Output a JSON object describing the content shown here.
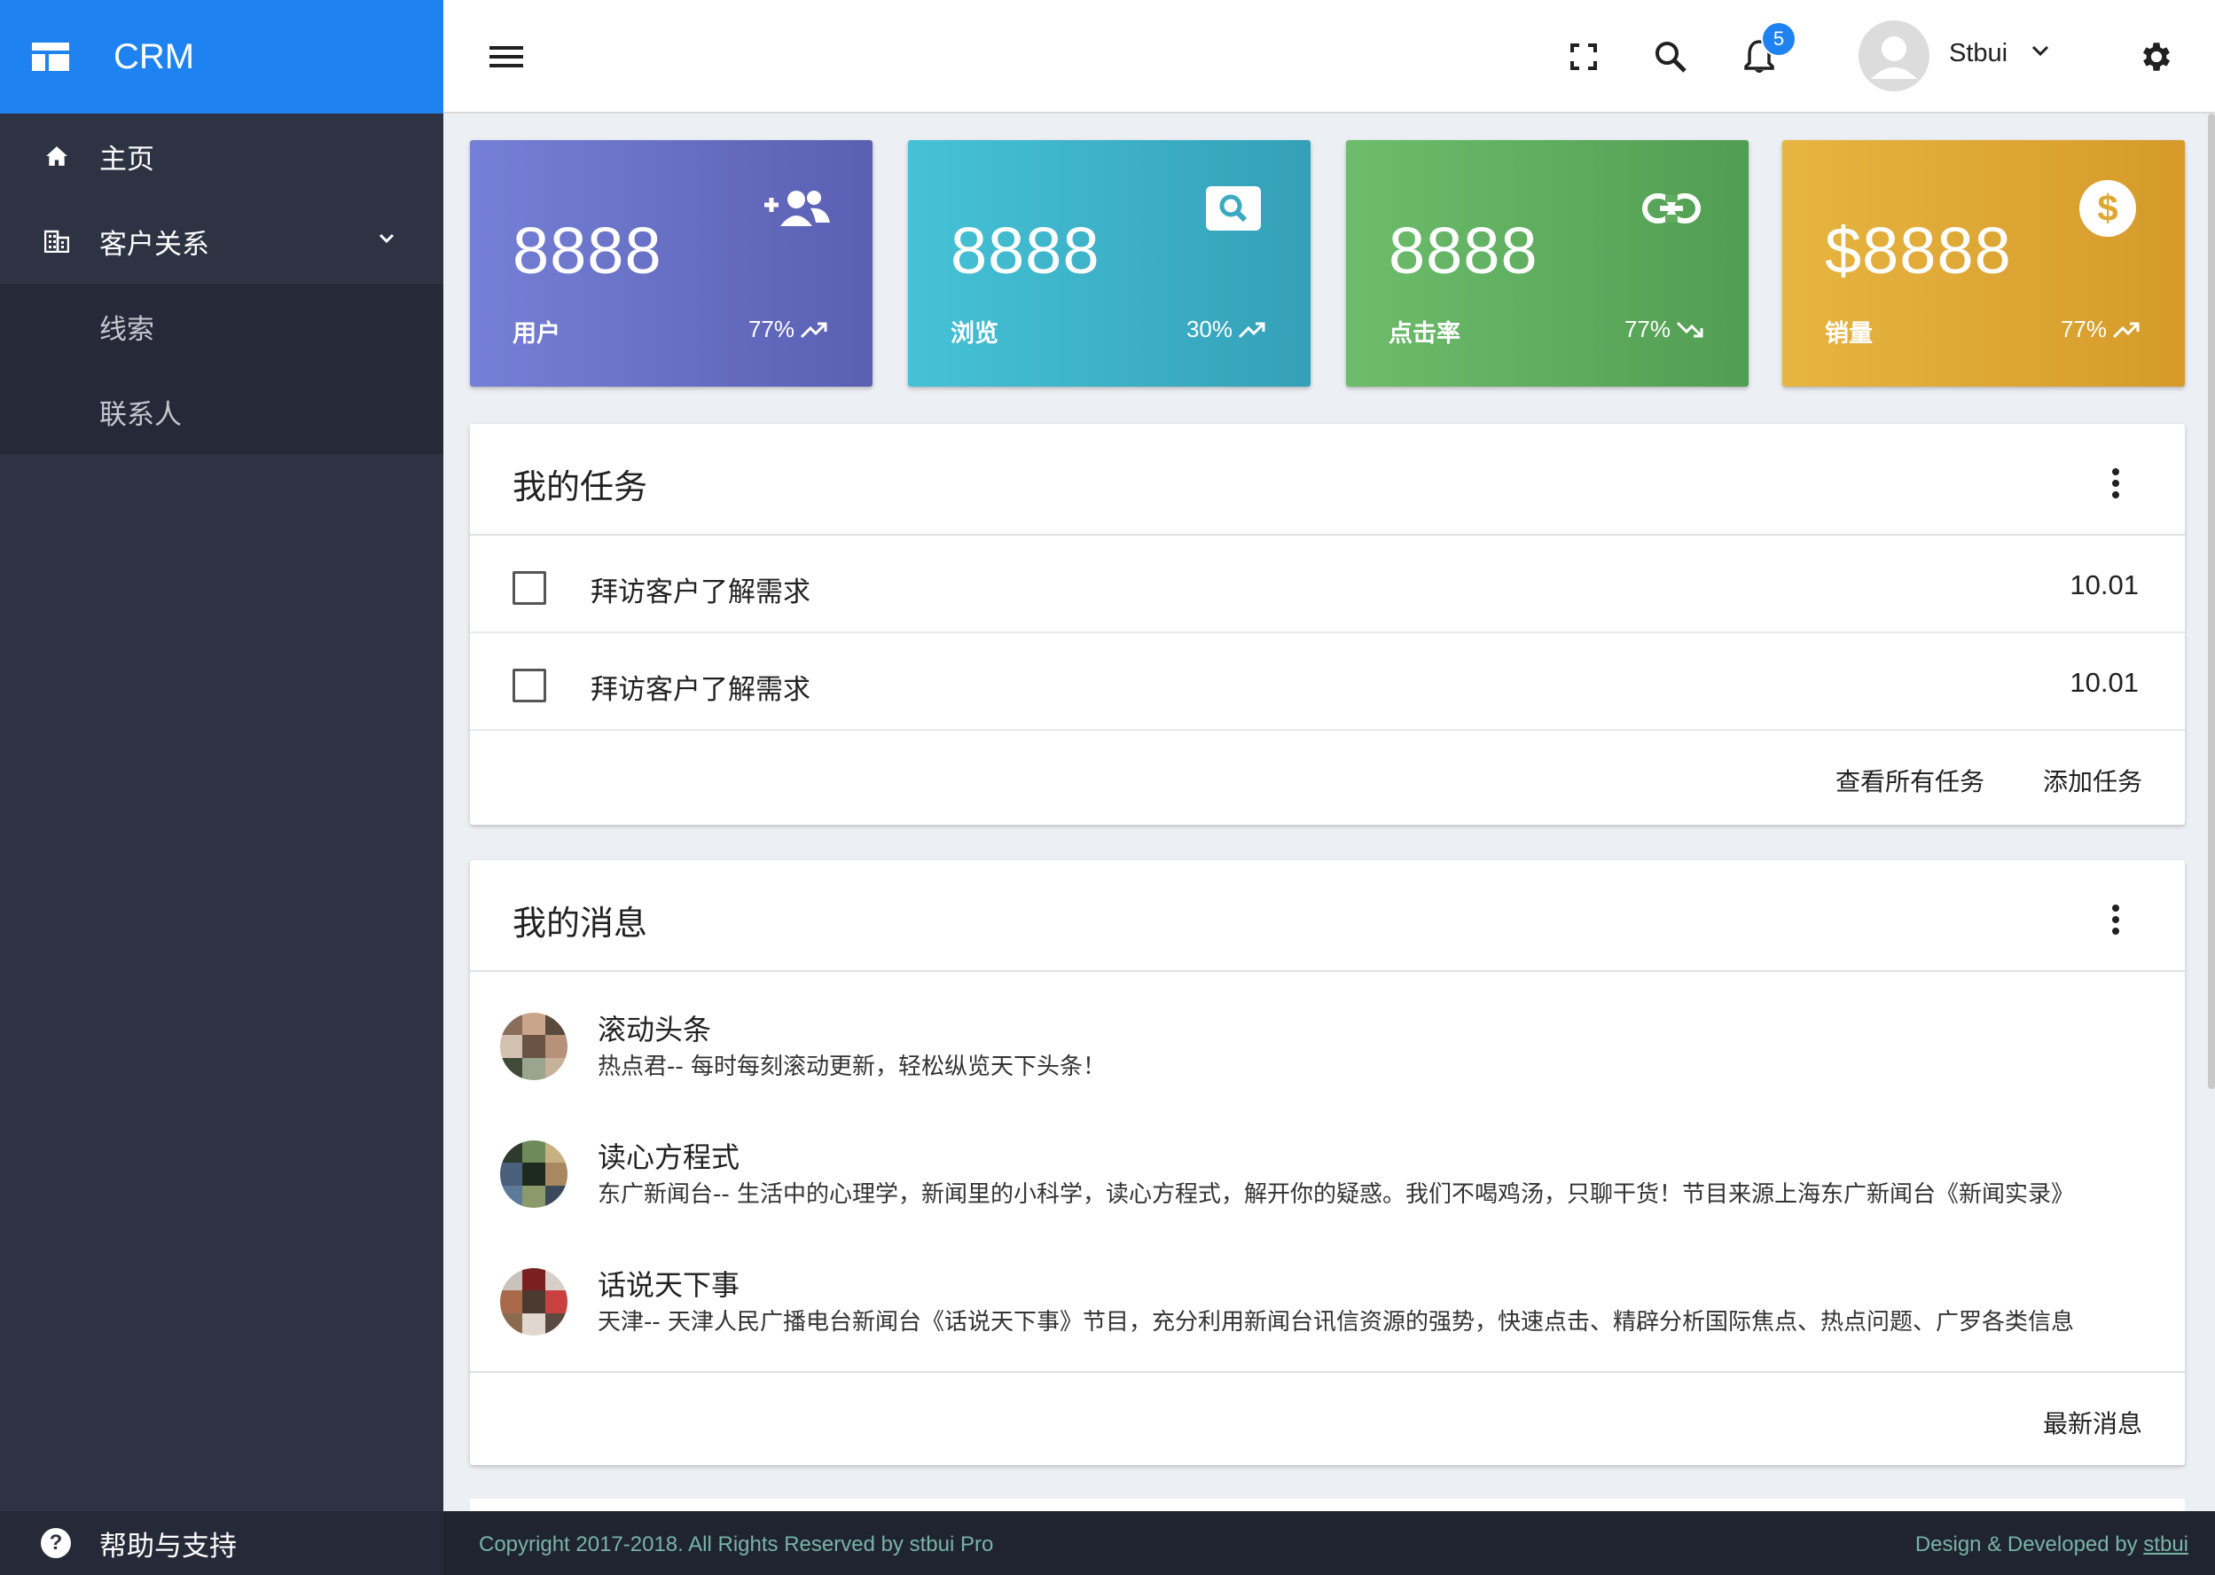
{
  "brand": {
    "name": "CRM"
  },
  "sidebar": {
    "items": [
      {
        "label": "主页",
        "icon": "home-icon"
      },
      {
        "label": "客户关系",
        "icon": "building-icon",
        "expanded": true
      }
    ],
    "subitems": [
      {
        "label": "线索"
      },
      {
        "label": "联系人"
      }
    ],
    "help": {
      "label": "帮助与支持"
    }
  },
  "topbar": {
    "notification_count": "5",
    "username": "Stbui"
  },
  "stats": [
    {
      "value": "8888",
      "label": "用户",
      "percent": "77%",
      "trend": "up",
      "icon": "add-group-icon",
      "color_from": "#7480d6",
      "color_to": "#5a5fb2"
    },
    {
      "value": "8888",
      "label": "浏览",
      "percent": "30%",
      "trend": "up",
      "icon": "search-box-icon",
      "color_from": "#45c2d6",
      "color_to": "#34a0b8"
    },
    {
      "value": "8888",
      "label": "点击率",
      "percent": "77%",
      "trend": "down",
      "icon": "link-icon",
      "color_from": "#6dbd6c",
      "color_to": "#519d52"
    },
    {
      "value": "$8888",
      "label": "销量",
      "percent": "77%",
      "trend": "up",
      "icon": "dollar-icon",
      "color_from": "#e7b541",
      "color_to": "#d59a2a"
    }
  ],
  "tasks_panel": {
    "title": "我的任务",
    "tasks": [
      {
        "text": "拜访客户了解需求",
        "date": "10.01"
      },
      {
        "text": "拜访客户了解需求",
        "date": "10.01"
      }
    ],
    "view_all_label": "查看所有任务",
    "add_label": "添加任务"
  },
  "messages_panel": {
    "title": "我的消息",
    "messages": [
      {
        "title": "滚动头条",
        "desc": "热点君-- 每时每刻滚动更新，轻松纵览天下头条！"
      },
      {
        "title": "读心方程式",
        "desc": "东广新闻台-- 生活中的心理学，新闻里的小科学，读心方程式，解开你的疑惑。我们不喝鸡汤，只聊干货！节目来源上海东广新闻台《新闻实录》"
      },
      {
        "title": "话说天下事",
        "desc": "天津-- 天津人民广播电台新闻台《话说天下事》节目，充分利用新闻台讯信资源的强势，快速点击、精辟分析国际焦点、热点问题、广罗各类信息"
      }
    ],
    "latest_label": "最新消息"
  },
  "footer": {
    "copyright": "Copyright 2017-2018. All Rights Reserved by stbui Pro",
    "credit_prefix": "Design & Developed by ",
    "credit_link": "stbui"
  }
}
